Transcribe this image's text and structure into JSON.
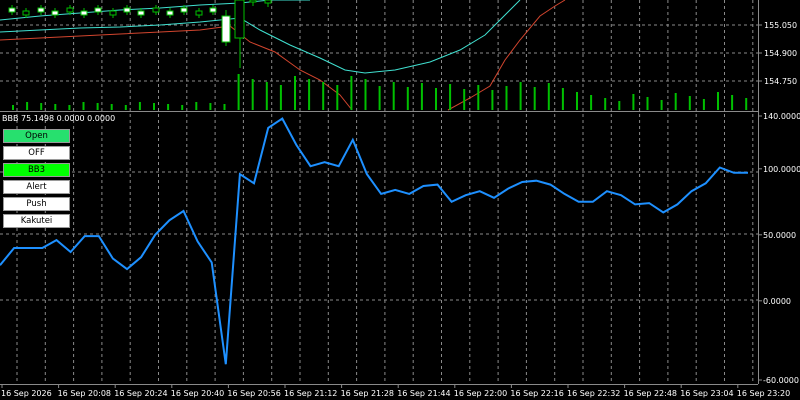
{
  "window": {
    "indicator_title": "BBB 75.1498 0.0000 0.0000"
  },
  "buttons": [
    {
      "label": "Open",
      "color": "#27e06e"
    },
    {
      "label": "OFF",
      "color": "#ffffff"
    },
    {
      "label": "BB3",
      "color": "#00ff00"
    },
    {
      "label": "Alert",
      "color": "#ffffff"
    },
    {
      "label": "Push",
      "color": "#ffffff"
    },
    {
      "label": "Kakutei",
      "color": "#ffffff"
    }
  ],
  "price_axis": {
    "labels": [
      "155.050",
      "154.900",
      "154.750"
    ]
  },
  "time_axis": {
    "labels": [
      "16 Sep 2026",
      "16 Sep 20:08",
      "16 Sep 20:24",
      "16 Sep 20:40",
      "16 Sep 20:56",
      "16 Sep 21:12",
      "16 Sep 21:28",
      "16 Sep 21:44",
      "16 Sep 22:00",
      "16 Sep 22:16",
      "16 Sep 22:32",
      "16 Sep 22:48",
      "16 Sep 23:04",
      "16 Sep 23:20"
    ]
  },
  "colors": {
    "background": "#000000",
    "grid": "#8a8a8a",
    "line": "#1e90ff",
    "bull": "#00c000",
    "band": "#40e0d0",
    "ma": "#d2452e",
    "volume": "#00c000"
  },
  "chart_data": [
    {
      "type": "bar",
      "title": "",
      "description_note": "",
      "categories": [],
      "values": [],
      "tick_labels_y": [
        "155.050",
        "154.900",
        "154.750"
      ]
    },
    {
      "type": "line",
      "title": "BBB 75.1498 0.0000 0.0000",
      "ylim": [
        -60,
        140
      ],
      "yticks": [
        "140.0000",
        "100.0000",
        "50.0000",
        "0.0000",
        "-60.0000"
      ],
      "series": [
        {
          "name": "BBB",
          "values": [
            27,
            40,
            40,
            40,
            46,
            37,
            49,
            49,
            32,
            24,
            33,
            50,
            61,
            68,
            45,
            29,
            -48,
            96,
            89,
            131,
            138,
            118,
            102,
            105,
            102,
            122,
            96,
            81,
            84,
            81,
            87,
            88,
            75,
            80,
            83,
            78,
            85,
            90,
            91,
            88,
            81,
            75,
            75,
            83,
            80,
            73,
            74,
            67,
            73,
            83,
            89,
            101,
            97,
            97
          ]
        }
      ]
    }
  ]
}
